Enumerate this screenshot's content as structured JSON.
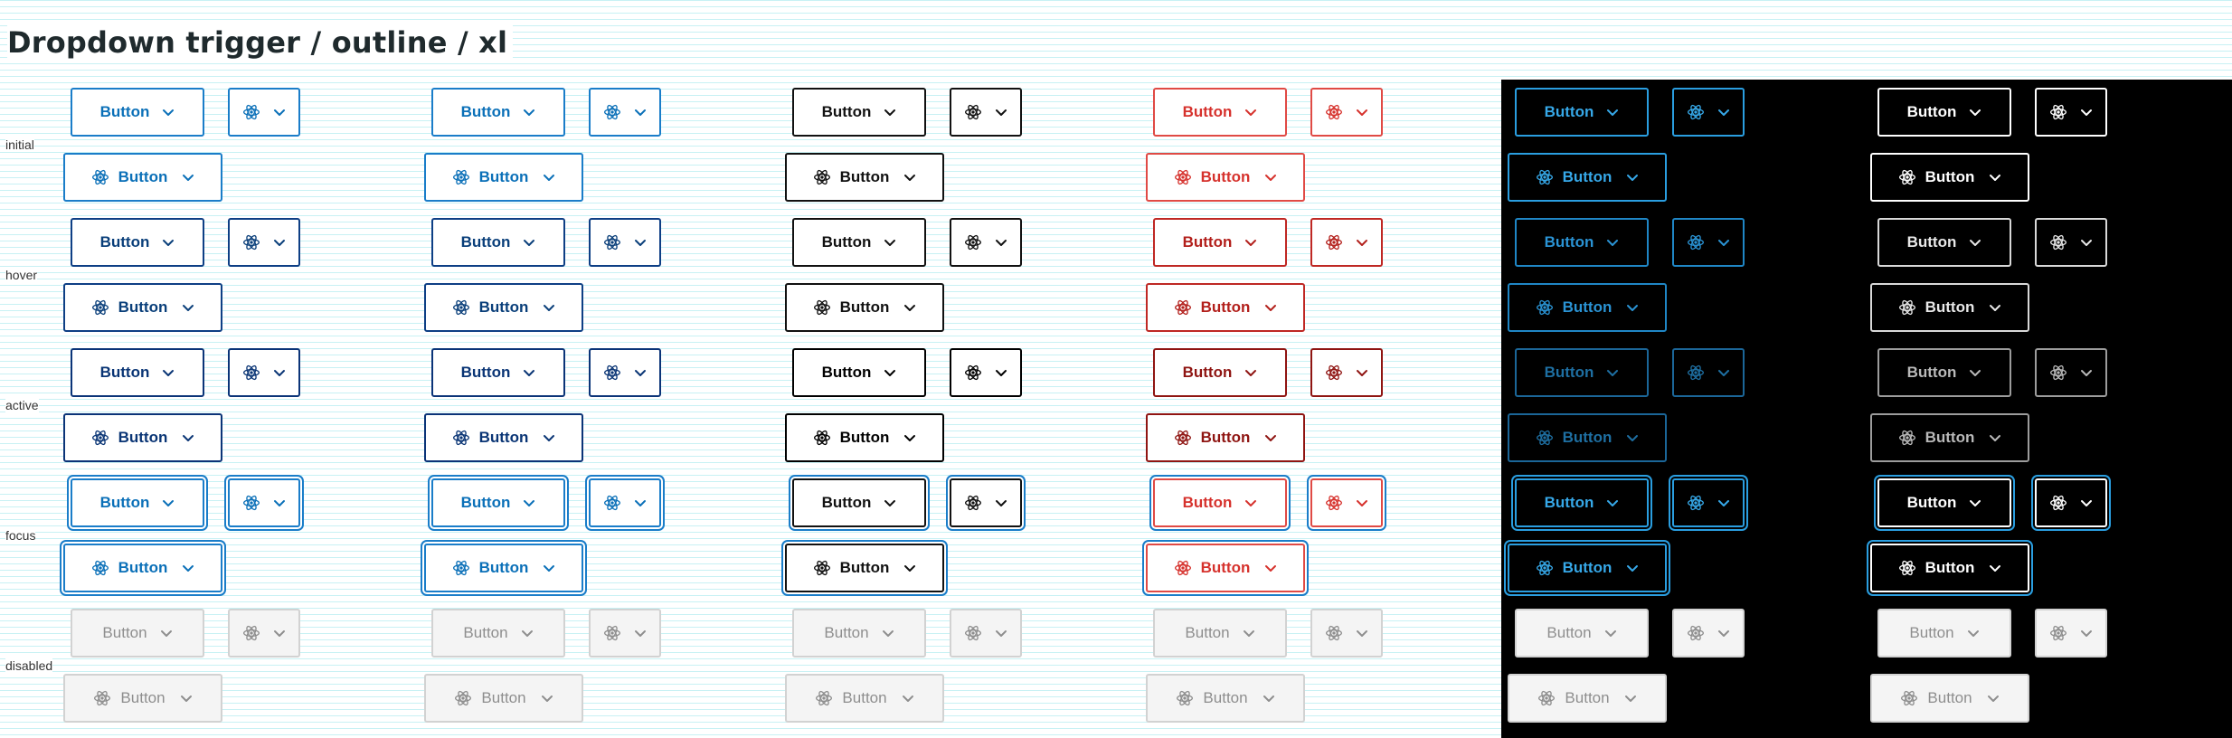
{
  "page": {
    "title": "Dropdown trigger / outline / xl"
  },
  "states": [
    {
      "id": "initial",
      "label": "initial"
    },
    {
      "id": "hover",
      "label": "hover"
    },
    {
      "id": "active",
      "label": "active"
    },
    {
      "id": "focus",
      "label": "focus"
    },
    {
      "id": "disabled",
      "label": "disabled"
    }
  ],
  "columns": [
    {
      "id": "blue",
      "theme": "light",
      "accent": "#1a7dc9"
    },
    {
      "id": "blue2",
      "theme": "light",
      "accent": "#1a7dc9"
    },
    {
      "id": "black",
      "theme": "light",
      "accent": "#111111"
    },
    {
      "id": "red",
      "theme": "light",
      "accent": "#e04a45"
    },
    {
      "id": "dark-blue",
      "theme": "dark",
      "accent": "#2a9ee0"
    },
    {
      "id": "dark-white",
      "theme": "dark",
      "accent": "#ffffff"
    }
  ],
  "button": {
    "label": "Button",
    "icon": "react-atom-icon",
    "trailing_icon": "chevron-down-icon"
  },
  "colors": {
    "grid_lines": "#c8f1f4",
    "dark_panel": "#000000",
    "disabled_text": "#8e8e8e",
    "disabled_bg": "#f4f4f4",
    "focus_ring": "#1a7dc9"
  }
}
